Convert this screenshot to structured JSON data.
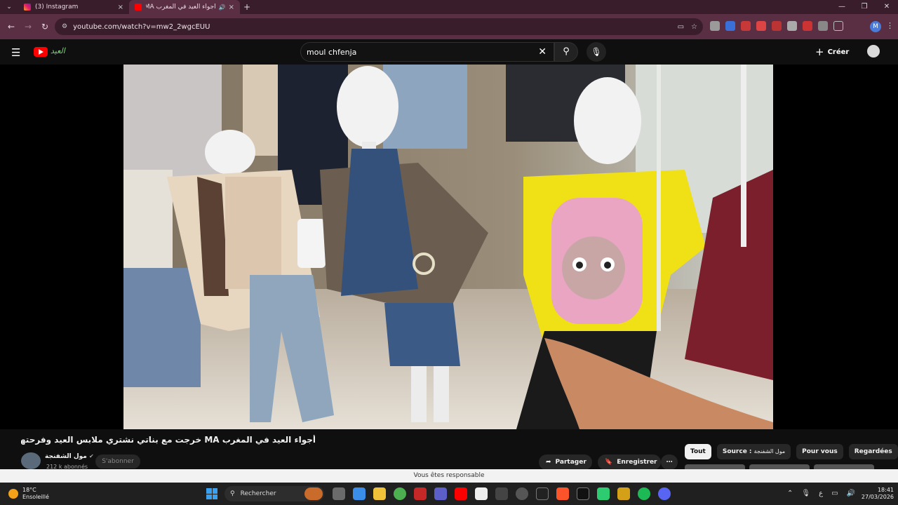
{
  "browser": {
    "tabs": [
      {
        "title": "(3) Instagram",
        "active": false,
        "close": "×"
      },
      {
        "title": "أجواء العيد في المغرب MA خ...",
        "active": true,
        "close": "×"
      }
    ],
    "new_tab": "+",
    "window_controls": [
      "—",
      "❐",
      "✕"
    ],
    "url": "youtube.com/watch?v=mw2_2wgcEUU",
    "profile_initial": "M"
  },
  "youtube": {
    "search_query": "moul chfenja",
    "create_label": "Créer",
    "video": {
      "title": "أجواء العيد في المغرب MA خرجت مع بناتي نشتري ملابس العيد وفرحتهم لا توصف 🛍️ ✨",
      "channel_name": "مول الشفنجة",
      "subscribers": "212 k abonnés",
      "subscribe_label": "S'abonner",
      "share_label": "Partager",
      "save_label": "Enregistrer"
    },
    "chips": [
      {
        "label": "Tout",
        "active": true
      },
      {
        "label": "Source : ",
        "suffix": "مول الشفنجة",
        "active": false
      },
      {
        "label": "Pour vous",
        "active": false
      },
      {
        "label": "Regardées",
        "active": false
      }
    ],
    "notification": "Vous êtes responsable"
  },
  "taskbar": {
    "weather_temp": "18°C",
    "weather_desc": "Ensoleillé",
    "search_label": "Rechercher",
    "time": "18:41",
    "date": "27/03/2026"
  },
  "colors": {
    "tabstrip_bg": "#3a1d2b",
    "toolbar_bg": "#5a2f43",
    "youtube_bg": "#0f0f0f",
    "youtube_red": "#ff0000"
  }
}
